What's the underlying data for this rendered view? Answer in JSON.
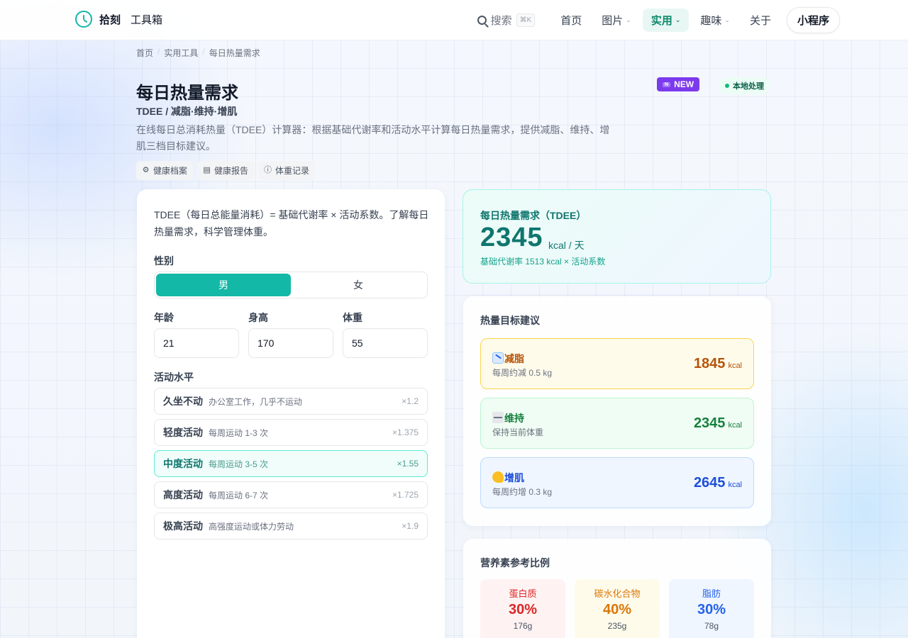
{
  "header": {
    "brand": "拾刻",
    "app_name": "工具箱",
    "search_label": "搜索",
    "search_shortcut": "⌘K",
    "nav": [
      {
        "label": "首页",
        "dropdown": false
      },
      {
        "label": "图片",
        "dropdown": true
      },
      {
        "label": "实用",
        "dropdown": true,
        "active": true
      },
      {
        "label": "趣味",
        "dropdown": true
      },
      {
        "label": "关于",
        "dropdown": false
      }
    ],
    "mini_program": "小程序"
  },
  "breadcrumb": [
    "首页",
    "实用工具",
    "每日热量需求"
  ],
  "page": {
    "title": "每日热量需求",
    "subtitle": "TDEE / 减脂·维持·增肌",
    "description": "在线每日总消耗热量（TDEE）计算器：根据基础代谢率和活动水平计算每日热量需求，提供减脂、维持、增肌三档目标建议。",
    "badge_new": "NEW",
    "badge_new_icon": "N",
    "badge_local": "本地处理",
    "related": [
      {
        "label": "健康档案",
        "icon": "gear-icon"
      },
      {
        "label": "健康报告",
        "icon": "document-icon"
      },
      {
        "label": "体重记录",
        "icon": "info-icon"
      }
    ]
  },
  "form": {
    "intro": "TDEE（每日总能量消耗）= 基础代谢率 × 活动系数。了解每日热量需求，科学管理体重。",
    "gender_label": "性别",
    "gender_options": [
      "男",
      "女"
    ],
    "gender_selected": "男",
    "age_label": "年龄",
    "age_value": "21",
    "height_label": "身高",
    "height_value": "170",
    "weight_label": "体重",
    "weight_value": "55",
    "activity_label": "活动水平",
    "activities": [
      {
        "name": "久坐不动",
        "desc": "办公室工作，几乎不运动",
        "factor": "×1.2"
      },
      {
        "name": "轻度活动",
        "desc": "每周运动 1-3 次",
        "factor": "×1.375"
      },
      {
        "name": "中度活动",
        "desc": "每周运动 3-5 次",
        "factor": "×1.55",
        "selected": true
      },
      {
        "name": "高度活动",
        "desc": "每周运动 6-7 次",
        "factor": "×1.725"
      },
      {
        "name": "极高活动",
        "desc": "高强度运动或体力劳动",
        "factor": "×1.9"
      }
    ]
  },
  "result": {
    "title": "每日热量需求（TDEE）",
    "value": "2345",
    "unit": "kcal / 天",
    "detail": "基础代谢率 1513 kcal × 活动系数"
  },
  "goals": {
    "title": "热量目标建议",
    "items": [
      {
        "name": "减脂",
        "icon": "chart-down-icon",
        "desc": "每周约减 0.5 kg",
        "value": "1845",
        "unit": "kcal"
      },
      {
        "name": "维持",
        "icon": "scale-icon",
        "desc": "保持当前体重",
        "value": "2345",
        "unit": "kcal"
      },
      {
        "name": "增肌",
        "icon": "flexed-arm-icon",
        "desc": "每周约增 0.3 kg",
        "value": "2645",
        "unit": "kcal"
      }
    ]
  },
  "nutrition": {
    "title": "营养素参考比例",
    "items": [
      {
        "name": "蛋白质",
        "percent": "30%",
        "grams": "176g"
      },
      {
        "name": "碳水化合物",
        "percent": "40%",
        "grams": "235g"
      },
      {
        "name": "脂肪",
        "percent": "30%",
        "grams": "78g"
      }
    ]
  },
  "colors": {
    "accent": "#14b8a6",
    "badge_new": "#7c3aed",
    "lose": "#b45309",
    "keep": "#15803d",
    "gain": "#1d4ed8"
  }
}
